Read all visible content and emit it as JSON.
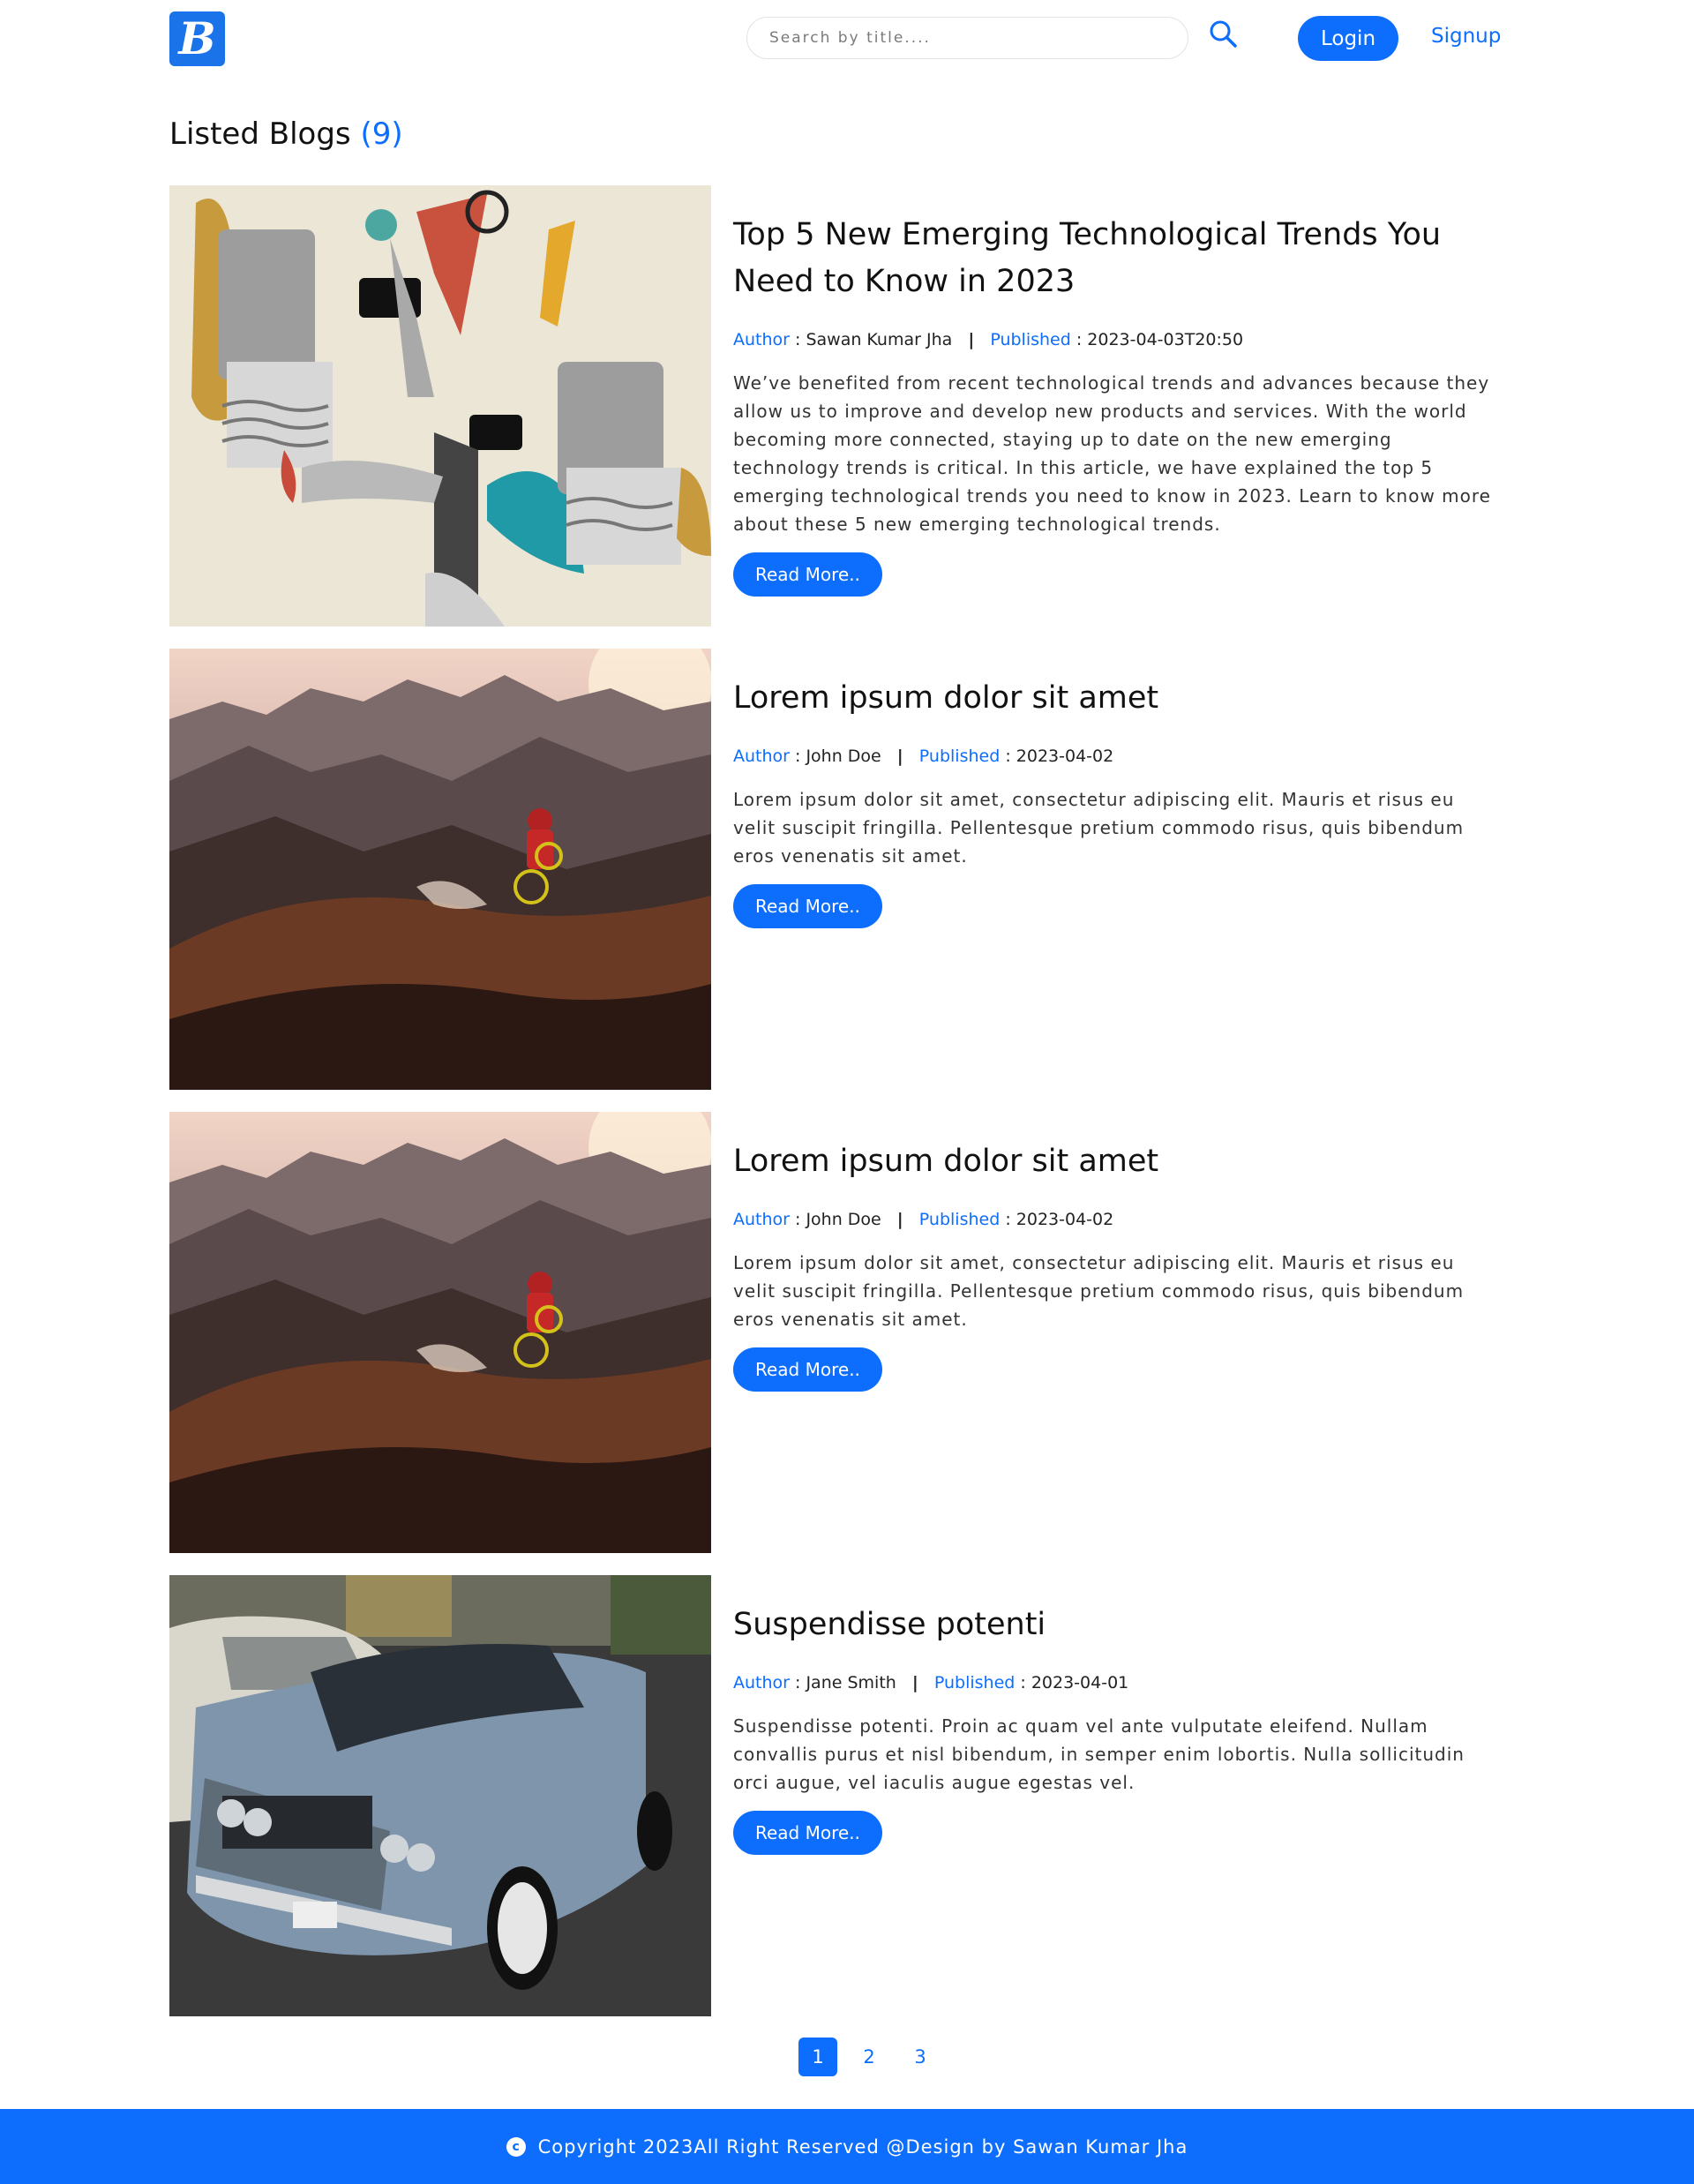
{
  "header": {
    "logo_letter": "B",
    "search_placeholder": "Search by title....",
    "login_label": "Login",
    "signup_label": "Signup"
  },
  "heading": {
    "title": "Listed Blogs",
    "count": "(9)"
  },
  "blogs": [
    {
      "title": "Top 5 New Emerging Technological Trends You Need to Know in 2023",
      "author_label": "Author",
      "author": "Sawan Kumar Jha",
      "published_label": "Published",
      "published": "2023-04-03T20:50",
      "description": "We’ve benefited from recent technological trends and advances because they allow us to improve and develop new products and services. With the world becoming more connected, staying up to date on the new emerging technology trends is critical. In this article, we have explained the top 5 emerging technological trends you need to know in 2023. Learn to know more about these 5 new emerging technological trends.",
      "read_more": "Read More.."
    },
    {
      "title": "Lorem ipsum dolor sit amet",
      "author_label": "Author",
      "author": "John Doe",
      "published_label": "Published",
      "published": "2023-04-02",
      "description": "Lorem ipsum dolor sit amet, consectetur adipiscing elit. Mauris et risus eu velit suscipit fringilla. Pellentesque pretium commodo risus, quis bibendum eros venenatis sit amet.",
      "read_more": "Read More.."
    },
    {
      "title": "Lorem ipsum dolor sit amet",
      "author_label": "Author",
      "author": "John Doe",
      "published_label": "Published",
      "published": "2023-04-02",
      "description": "Lorem ipsum dolor sit amet, consectetur adipiscing elit. Mauris et risus eu velit suscipit fringilla. Pellentesque pretium commodo risus, quis bibendum eros venenatis sit amet.",
      "read_more": "Read More.."
    },
    {
      "title": "Suspendisse potenti",
      "author_label": "Author",
      "author": "Jane Smith",
      "published_label": "Published",
      "published": "2023-04-01",
      "description": "Suspendisse potenti. Proin ac quam vel ante vulputate eleifend. Nullam convallis purus et nisl bibendum, in semper enim lobortis. Nulla sollicitudin orci augue, vel iaculis augue egestas vel.",
      "read_more": "Read More.."
    }
  ],
  "pagination": {
    "pages": [
      "1",
      "2",
      "3"
    ],
    "active": "1"
  },
  "footer": {
    "copyright_icon": "c",
    "text": "Copyright 2023All Right Reserved @Design by Sawan Kumar Jha"
  },
  "icons": {
    "search": "search-icon",
    "copyright": "copyright-icon"
  },
  "colors": {
    "primary": "#0d6efd",
    "logo_bg": "#1a73e8"
  }
}
